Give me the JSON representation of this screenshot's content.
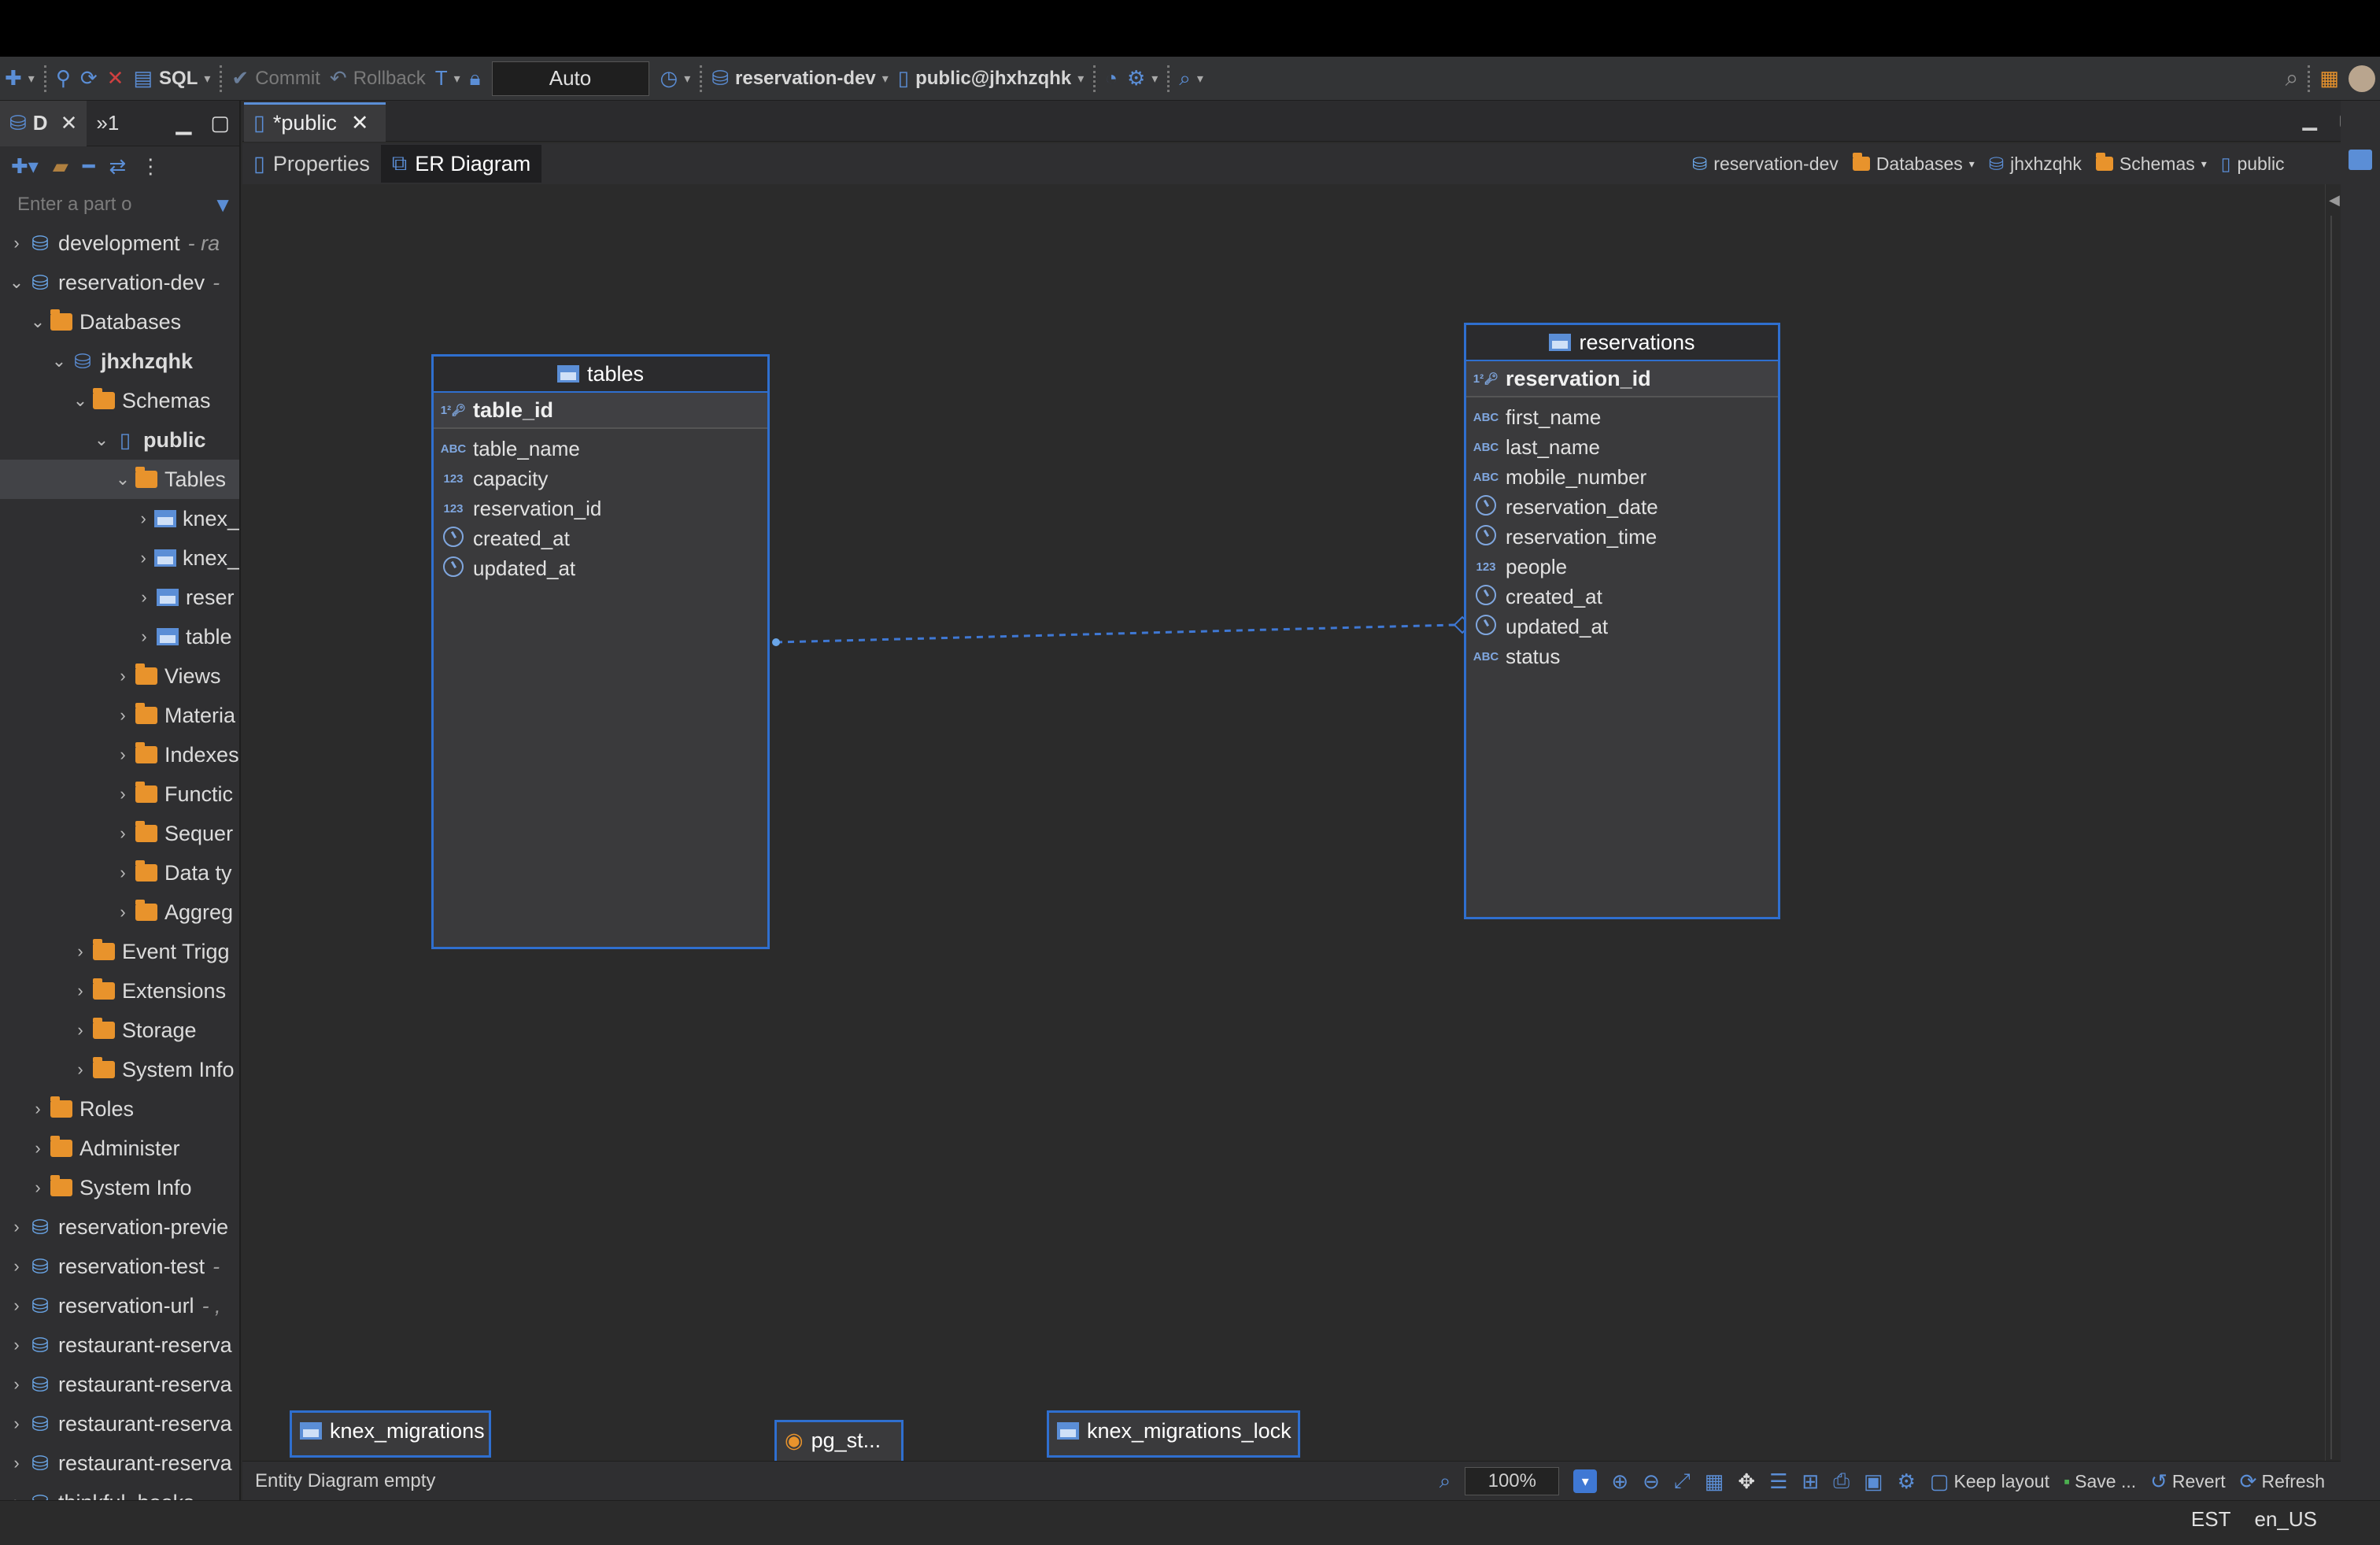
{
  "toolbar": {
    "sql_label": "SQL",
    "commit_label": "Commit",
    "rollback_label": "Rollback",
    "tx_mode": "Auto",
    "connection": "reservation-dev",
    "schema": "public@jhxhzqhk"
  },
  "left_panel": {
    "tab_label": "D",
    "tab2_label": "»1",
    "filter_placeholder": "Enter a part o",
    "tree": [
      {
        "label": "development",
        "hint": "- ra",
        "level": 0,
        "icon": "postgres-icon"
      },
      {
        "label": "reservation-dev",
        "hint": "-",
        "level": 0,
        "icon": "postgres-icon",
        "expanded": true
      },
      {
        "label": "Databases",
        "level": 1,
        "icon": "folder-icon",
        "expanded": true
      },
      {
        "label": "jhxhzqhk",
        "level": 2,
        "icon": "database-icon",
        "bold": true,
        "expanded": true
      },
      {
        "label": "Schemas",
        "level": 3,
        "icon": "folder-icon",
        "expanded": true
      },
      {
        "label": "public",
        "level": 4,
        "icon": "schema-icon",
        "bold": true,
        "expanded": true
      },
      {
        "label": "Tables",
        "level": 5,
        "icon": "folder-icon",
        "expanded": true,
        "selected": true
      },
      {
        "label": "knex_",
        "level": 6,
        "icon": "table-icon"
      },
      {
        "label": "knex_",
        "level": 6,
        "icon": "table-icon"
      },
      {
        "label": "reser",
        "level": 6,
        "icon": "table-icon"
      },
      {
        "label": "table",
        "level": 6,
        "icon": "table-icon"
      },
      {
        "label": "Views",
        "level": 5,
        "icon": "folder-icon"
      },
      {
        "label": "Materia",
        "level": 5,
        "icon": "folder-icon"
      },
      {
        "label": "Indexes",
        "level": 5,
        "icon": "folder-icon"
      },
      {
        "label": "Functic",
        "level": 5,
        "icon": "folder-icon"
      },
      {
        "label": "Sequer",
        "level": 5,
        "icon": "folder-icon"
      },
      {
        "label": "Data ty",
        "level": 5,
        "icon": "folder-icon"
      },
      {
        "label": "Aggreg",
        "level": 5,
        "icon": "folder-icon"
      },
      {
        "label": "Event Trigg",
        "level": 3,
        "icon": "folder-icon"
      },
      {
        "label": "Extensions",
        "level": 3,
        "icon": "folder-icon"
      },
      {
        "label": "Storage",
        "level": 3,
        "icon": "folder-icon"
      },
      {
        "label": "System Info",
        "level": 3,
        "icon": "folder-icon"
      },
      {
        "label": "Roles",
        "level": 1,
        "icon": "folder-icon"
      },
      {
        "label": "Administer",
        "level": 1,
        "icon": "folder-icon"
      },
      {
        "label": "System Info",
        "level": 1,
        "icon": "folder-icon"
      },
      {
        "label": "reservation-previe",
        "level": 0,
        "icon": "postgres-icon"
      },
      {
        "label": "reservation-test",
        "hint": "-",
        "level": 0,
        "icon": "postgres-icon"
      },
      {
        "label": "reservation-url",
        "hint": "- ,",
        "level": 0,
        "icon": "postgres-icon"
      },
      {
        "label": "restaurant-reserva",
        "level": 0,
        "icon": "postgres-icon"
      },
      {
        "label": "restaurant-reserva",
        "level": 0,
        "icon": "postgres-icon"
      },
      {
        "label": "restaurant-reserva",
        "level": 0,
        "icon": "postgres-icon"
      },
      {
        "label": "restaurant-reserva",
        "level": 0,
        "icon": "postgres-icon"
      },
      {
        "label": "thinkful_books",
        "hint": "-",
        "level": 0,
        "icon": "postgres-icon"
      }
    ]
  },
  "editor": {
    "tab_title": "*public",
    "subtabs": [
      "Properties",
      "ER Diagram"
    ],
    "breadcrumbs": [
      "reservation-dev",
      "Databases",
      "jhxhzqhk",
      "Schemas",
      "public"
    ]
  },
  "diagram": {
    "tables_entity": {
      "name": "tables",
      "pk": "table_id",
      "columns": [
        {
          "name": "table_name",
          "type": "ABC"
        },
        {
          "name": "capacity",
          "type": "123"
        },
        {
          "name": "reservation_id",
          "type": "123"
        },
        {
          "name": "created_at",
          "type": "clock"
        },
        {
          "name": "updated_at",
          "type": "clock"
        }
      ]
    },
    "reservations_entity": {
      "name": "reservations",
      "pk": "reservation_id",
      "columns": [
        {
          "name": "first_name",
          "type": "ABC"
        },
        {
          "name": "last_name",
          "type": "ABC"
        },
        {
          "name": "mobile_number",
          "type": "ABC"
        },
        {
          "name": "reservation_date",
          "type": "clock"
        },
        {
          "name": "reservation_time",
          "type": "clock"
        },
        {
          "name": "people",
          "type": "123"
        },
        {
          "name": "created_at",
          "type": "clock"
        },
        {
          "name": "updated_at",
          "type": "clock"
        },
        {
          "name": "status",
          "type": "ABC"
        }
      ]
    },
    "bottom_entities": [
      "knex_migrations",
      "pg_st...",
      "knex_migrations_lock"
    ]
  },
  "statusbar": {
    "text": "Entity Diagram  empty",
    "zoom": "100%",
    "keep_layout": "Keep layout",
    "save": "Save ...",
    "revert": "Revert",
    "refresh": "Refresh"
  },
  "bottombar": {
    "timezone": "EST",
    "locale": "en_US"
  },
  "colors": {
    "accent": "#2f6fcf",
    "folder": "#e8932c"
  }
}
